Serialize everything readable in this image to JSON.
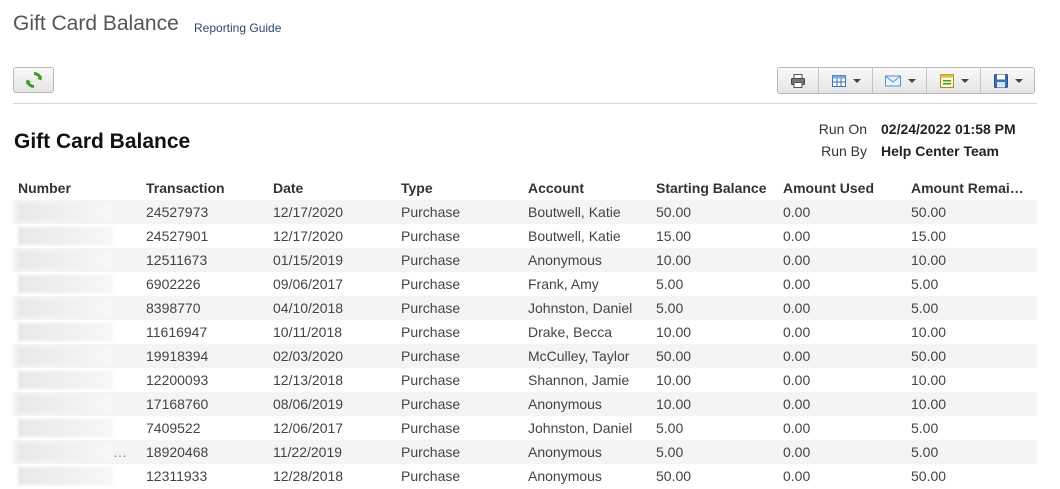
{
  "header": {
    "title": "Gift Card Balance",
    "link": "Reporting Guide"
  },
  "toolbar": {
    "refresh_icon": "refresh-icon",
    "buttons": [
      {
        "icon": "print-icon",
        "dropdown": false
      },
      {
        "icon": "grid-icon",
        "dropdown": true
      },
      {
        "icon": "email-icon",
        "dropdown": true
      },
      {
        "icon": "export-icon",
        "dropdown": true
      },
      {
        "icon": "save-icon",
        "dropdown": true
      }
    ]
  },
  "report": {
    "title": "Gift Card Balance",
    "run_on_label": "Run On",
    "run_on_value": "02/24/2022 01:58 PM",
    "run_by_label": "Run By",
    "run_by_value": "Help Center Team"
  },
  "table": {
    "columns": [
      "Number",
      "Transaction",
      "Date",
      "Type",
      "Account",
      "Starting Balance",
      "Amount Used",
      "Amount Remai…"
    ],
    "rows": [
      {
        "number": "",
        "transaction": "24527973",
        "date": "12/17/2020",
        "type": "Purchase",
        "account": "Boutwell, Katie",
        "starting": "50.00",
        "used": "0.00",
        "remaining": "50.00"
      },
      {
        "number": "",
        "transaction": "24527901",
        "date": "12/17/2020",
        "type": "Purchase",
        "account": "Boutwell, Katie",
        "starting": "15.00",
        "used": "0.00",
        "remaining": "15.00"
      },
      {
        "number": "",
        "transaction": "12511673",
        "date": "01/15/2019",
        "type": "Purchase",
        "account": "Anonymous",
        "starting": "10.00",
        "used": "0.00",
        "remaining": "10.00"
      },
      {
        "number": "",
        "transaction": "6902226",
        "date": "09/06/2017",
        "type": "Purchase",
        "account": "Frank, Amy",
        "starting": "5.00",
        "used": "0.00",
        "remaining": "5.00"
      },
      {
        "number": "",
        "transaction": "8398770",
        "date": "04/10/2018",
        "type": "Purchase",
        "account": "Johnston, Daniel",
        "starting": "5.00",
        "used": "0.00",
        "remaining": "5.00"
      },
      {
        "number": "",
        "transaction": "11616947",
        "date": "10/11/2018",
        "type": "Purchase",
        "account": "Drake, Becca",
        "starting": "10.00",
        "used": "0.00",
        "remaining": "10.00"
      },
      {
        "number": "",
        "transaction": "19918394",
        "date": "02/03/2020",
        "type": "Purchase",
        "account": "McCulley, Taylor",
        "starting": "50.00",
        "used": "0.00",
        "remaining": "50.00"
      },
      {
        "number": "",
        "transaction": "12200093",
        "date": "12/13/2018",
        "type": "Purchase",
        "account": "Shannon, Jamie",
        "starting": "10.00",
        "used": "0.00",
        "remaining": "10.00"
      },
      {
        "number": "",
        "transaction": "17168760",
        "date": "08/06/2019",
        "type": "Purchase",
        "account": "Anonymous",
        "starting": "10.00",
        "used": "0.00",
        "remaining": "10.00"
      },
      {
        "number": "",
        "transaction": "7409522",
        "date": "12/06/2017",
        "type": "Purchase",
        "account": "Johnston, Daniel",
        "starting": "5.00",
        "used": "0.00",
        "remaining": "5.00"
      },
      {
        "number": "…",
        "transaction": "18920468",
        "date": "11/22/2019",
        "type": "Purchase",
        "account": "Anonymous",
        "starting": "5.00",
        "used": "0.00",
        "remaining": "5.00"
      },
      {
        "number": "",
        "transaction": "12311933",
        "date": "12/28/2018",
        "type": "Purchase",
        "account": "Anonymous",
        "starting": "50.00",
        "used": "0.00",
        "remaining": "50.00"
      }
    ]
  }
}
